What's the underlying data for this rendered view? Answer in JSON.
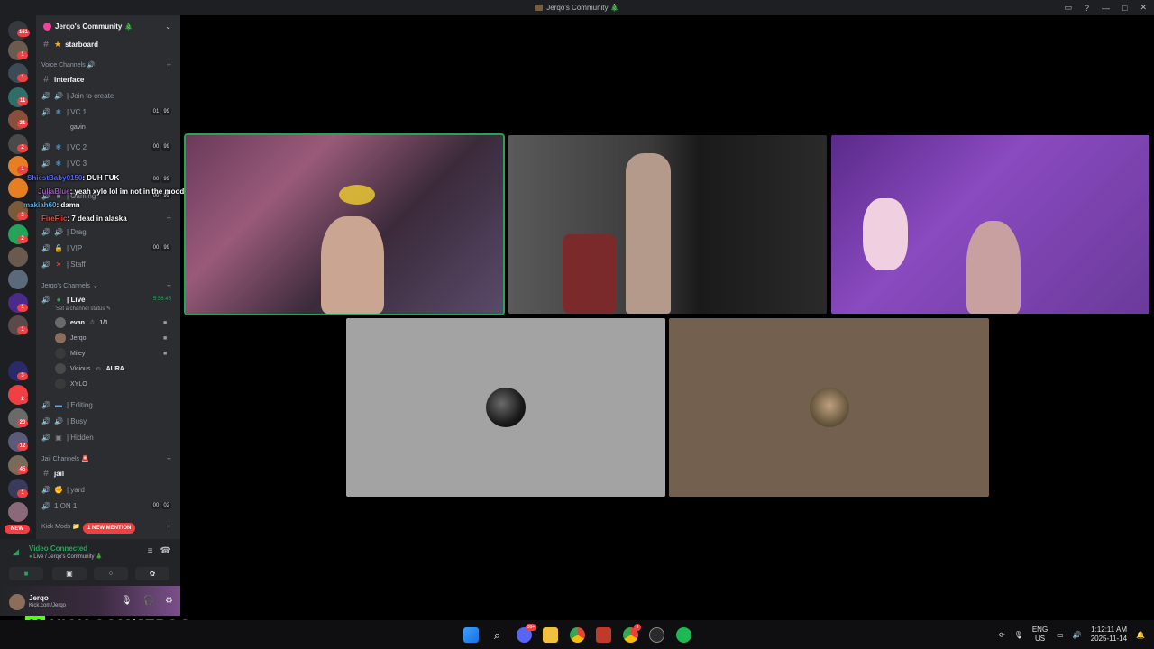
{
  "window": {
    "title": "Jerqo's Community 🎄",
    "controls": [
      "inbox-icon",
      "help-icon",
      "minimize",
      "maximize",
      "close"
    ]
  },
  "rail": {
    "badges": [
      "161",
      "1",
      "1",
      "11",
      "21",
      "2",
      "1",
      "3",
      "2",
      "1",
      "1",
      "3",
      "2",
      "1",
      "2",
      "20",
      "12",
      "45",
      "1",
      "1"
    ],
    "new_label": "NEW"
  },
  "server": {
    "name": "Jerqo's Community 🎄"
  },
  "channels": {
    "starboard": "starboard",
    "voice_category": "Voice Channels 🔊",
    "interface": "interface",
    "join_to_create": "| Join to create",
    "vc1": "| VC 1",
    "vc1_count": [
      "01",
      "99"
    ],
    "vc1_user": "gavin",
    "vc2": "| VC 2",
    "vc2_count": [
      "00",
      "99"
    ],
    "vc3": "| VC 3",
    "vc3_count": [
      "00",
      "99"
    ],
    "gaming": "| Gaming",
    "gaming_count": [
      "00",
      "99"
    ],
    "drag": "| Drag",
    "vip": "| VIP",
    "vip_count": [
      "00",
      "99"
    ],
    "staff": "| Staff",
    "jerqo_category": "Jerqo's Channels",
    "live": "| Live",
    "live_time": "5:56:45",
    "live_status": "Set a channel status",
    "live_users": [
      "evan",
      "Jerqo",
      "Miley",
      "Vicious",
      "XYLO"
    ],
    "evan_tag": "1/1",
    "vicious_tag": "AURA",
    "editing": "| Editing",
    "busy": "| Busy",
    "hidden": "| Hidden",
    "jail_category": "Jail Channels 🚨",
    "jail": "jail",
    "yard": "| yard",
    "one_on_one": "1 ON 1",
    "one_on_one_count": [
      "00",
      "02"
    ],
    "kick_category": "Kick Mods 📁",
    "mention_badge": "1 NEW MENTION"
  },
  "chat_overlay": [
    {
      "user": "ShiestBaby0150",
      "text": ": DUH FUK"
    },
    {
      "user": "JuliaBlue",
      "text": ": yeah xylo lol im not in the mood to be on stream thanks"
    },
    {
      "user": "makiah60",
      "text": ": damn"
    },
    {
      "user": "FireFlic",
      "text": ": 7 dead in alaska"
    }
  ],
  "voice_panel": {
    "status": "Video Connected",
    "location": "Live / Jerqo's Community 🎄"
  },
  "user_panel": {
    "name": "Jerqo",
    "sub": "Kick.com/Jerqo"
  },
  "overlay_banner": {
    "logo": "K",
    "text": "KICK.COM/JERQO"
  },
  "video_tiles": [
    {
      "name": "tile-cam-1",
      "speaking": true
    },
    {
      "name": "tile-cam-2",
      "speaking": false
    },
    {
      "name": "tile-cam-3",
      "speaking": false
    },
    {
      "name": "tile-avatar-1",
      "speaking": false
    },
    {
      "name": "tile-avatar-2",
      "speaking": false
    }
  ],
  "taskbar": {
    "lang_top": "ENG",
    "lang_bottom": "US",
    "time": "1:12:11 AM",
    "date": "2025-11-14",
    "discord_badge": "99+",
    "chrome2_badge": "3"
  },
  "colors": {
    "accent_green": "#23a559",
    "kick_green": "#53fc18",
    "badge_red": "#f23f42"
  }
}
